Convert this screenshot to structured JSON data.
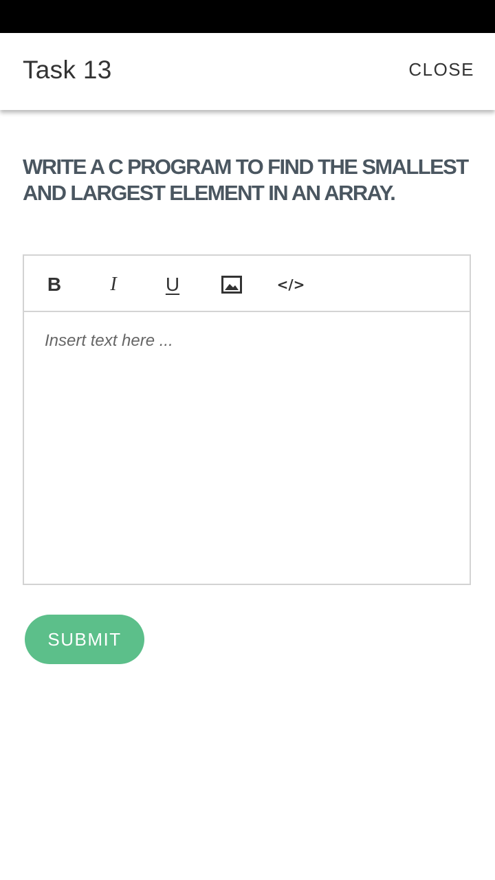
{
  "header": {
    "title": "Task 13",
    "close_label": "CLOSE"
  },
  "question": {
    "text": "WRITE A C PROGRAM TO FIND THE SMALLEST AND LARGEST ELEMENT IN AN ARRAY."
  },
  "editor": {
    "toolbar": {
      "bold_label": "B",
      "italic_label": "I",
      "underline_label": "U",
      "image_icon": "image-icon",
      "code_label": "</>"
    },
    "placeholder": "Insert text here ..."
  },
  "submit": {
    "label": "SUBMIT",
    "color": "#5cbf8a"
  },
  "colors": {
    "status_bar": "#000000",
    "question_text": "#4a5660",
    "border": "#d3d3d3"
  }
}
